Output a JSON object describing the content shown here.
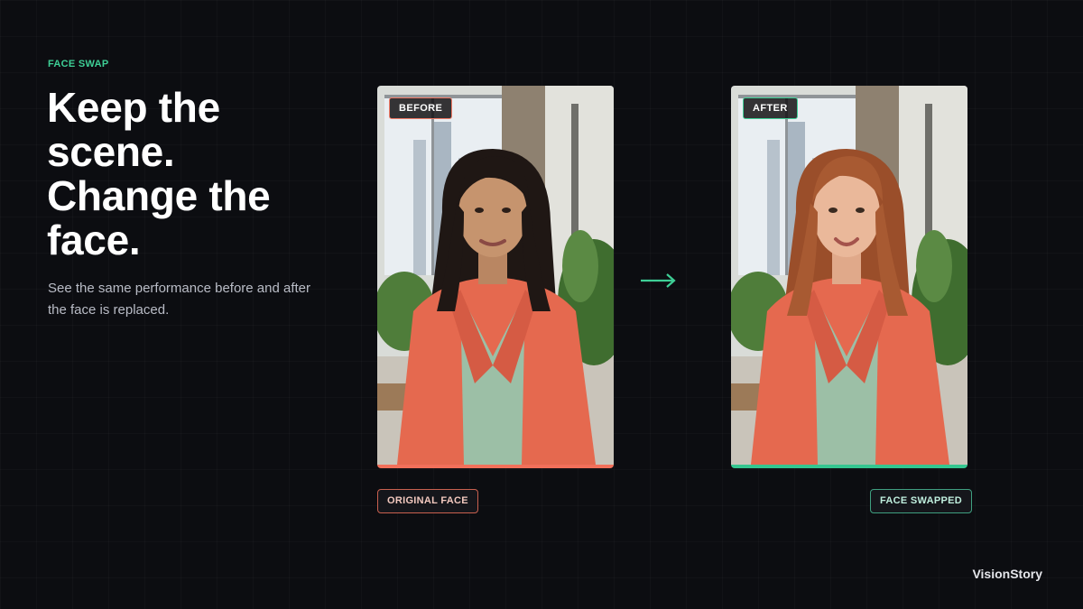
{
  "eyebrow": "FACE SWAP",
  "headline": {
    "line1": "Keep the",
    "line2": "scene.",
    "line3": "Change the",
    "line4": "face."
  },
  "subtitle": "See the same performance before and after the face is replaced.",
  "before_panel": {
    "tag": "BEFORE",
    "caption": "ORIGINAL FACE",
    "accent": "#f2705a"
  },
  "after_panel": {
    "tag": "AFTER",
    "caption": "FACE SWAPPED",
    "accent": "#34c690"
  },
  "arrow_icon": "arrow-right-icon",
  "brand": "VisionStory",
  "colors": {
    "background": "#0c0d11",
    "green": "#3ecf96",
    "coral": "#f2705a"
  }
}
